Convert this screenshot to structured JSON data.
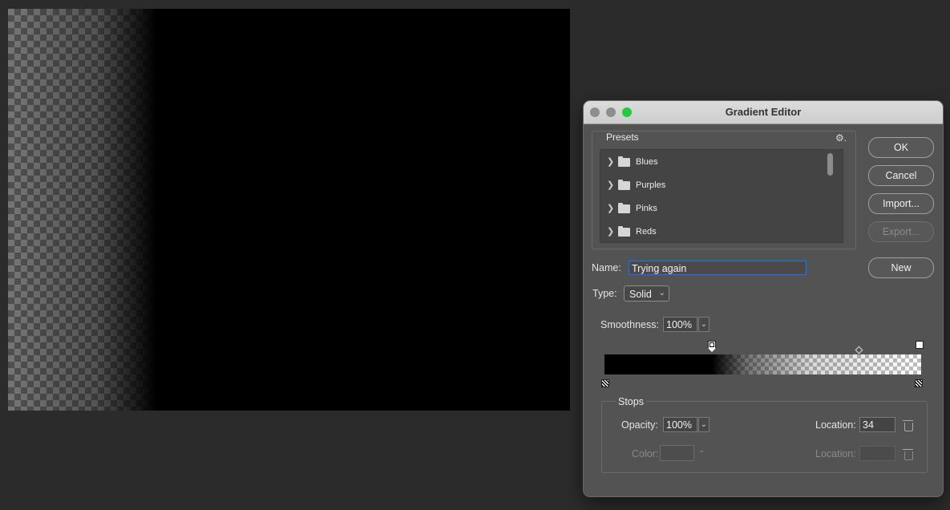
{
  "dialog": {
    "title": "Gradient Editor",
    "presets": {
      "label": "Presets",
      "items": [
        {
          "label": "Blues"
        },
        {
          "label": "Purples"
        },
        {
          "label": "Pinks"
        },
        {
          "label": "Reds"
        }
      ]
    },
    "buttons": {
      "ok": "OK",
      "cancel": "Cancel",
      "import": "Import...",
      "export": "Export...",
      "new": "New"
    },
    "name": {
      "label": "Name:",
      "value": "Trying again"
    },
    "type": {
      "label": "Type:",
      "value": "Solid"
    },
    "smoothness": {
      "label": "Smoothness:",
      "value": "100%"
    },
    "stops": {
      "label": "Stops",
      "opacity_label": "Opacity:",
      "opacity_value": "100%",
      "opacity_location_label": "Location:",
      "opacity_location_value": "34",
      "color_label": "Color:",
      "color_location_label": "Location:",
      "color_location_value": ""
    }
  },
  "colors": {
    "accent_focus": "#3d6fb8",
    "dialog_bg": "#535353",
    "app_bg": "#2b2b2b",
    "traffic_close": "#8e8e8e",
    "traffic_min": "#8e8e8e",
    "traffic_max": "#28c840"
  }
}
